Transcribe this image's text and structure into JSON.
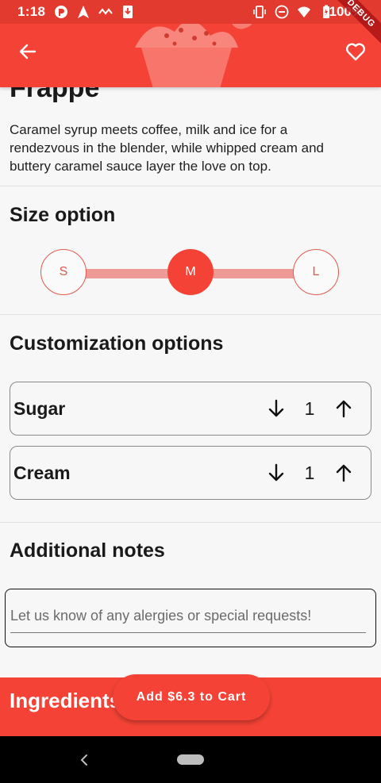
{
  "status_bar": {
    "time": "1:18",
    "battery": "100%"
  },
  "app_bar": {
    "debug_banner": "DEBUG"
  },
  "product": {
    "title": "Frappe",
    "description": "Caramel syrup meets coffee, milk and ice for a rendezvous in the blender, while whipped cream and buttery caramel sauce layer the love on top."
  },
  "size_section": {
    "title": "Size option",
    "options": [
      "S",
      "M",
      "L"
    ],
    "selected": "M"
  },
  "customization": {
    "title": "Customization options",
    "items": [
      {
        "label": "Sugar",
        "value": "1"
      },
      {
        "label": "Cream",
        "value": "1"
      }
    ]
  },
  "notes": {
    "title": "Additional notes",
    "placeholder": "Let us know of any alergies or special requests!"
  },
  "ingredients": {
    "title": "Ingredients"
  },
  "cart_button": {
    "label": "Add $6.3 to Cart"
  },
  "colors": {
    "primary": "#f44336",
    "status_bar": "#e23a2e",
    "track": "#ee9b98"
  },
  "icons": {
    "back": "arrow-left-icon",
    "favorite": "heart-outline-icon",
    "decrease": "arrow-down-icon",
    "increase": "arrow-up-icon"
  }
}
